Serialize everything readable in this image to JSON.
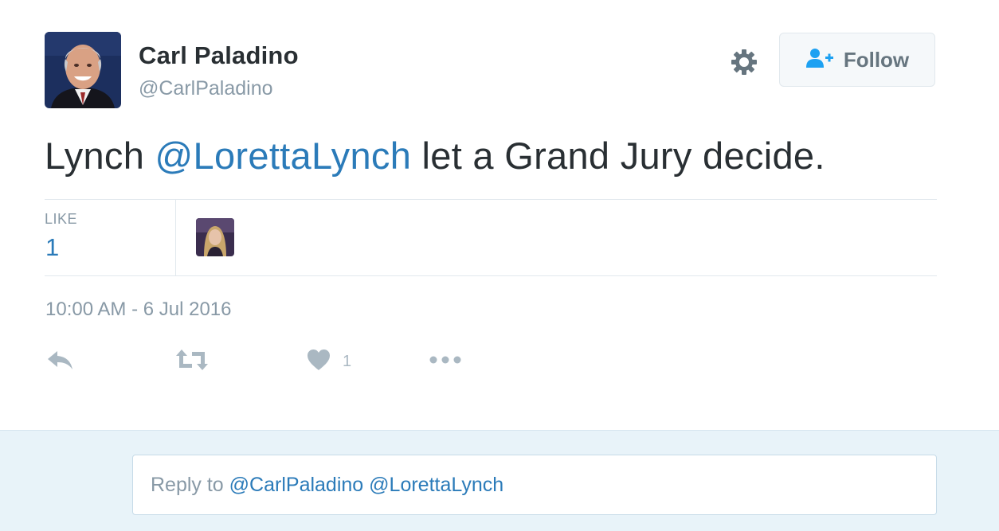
{
  "author": {
    "display_name": "Carl Paladino",
    "handle": "@CarlPaladino"
  },
  "header": {
    "settings_icon": "gear-icon",
    "follow_icon": "follow-user-icon",
    "follow_label": "Follow"
  },
  "tweet": {
    "text_before": "Lynch ",
    "mention": "@LorettaLynch",
    "text_after": " let a Grand Jury decide."
  },
  "stats": {
    "like_label": "LIKE",
    "like_count": "1"
  },
  "timestamp": "10:00 AM - 6 Jul 2016",
  "actions": {
    "reply_icon": "reply-icon",
    "retweet_icon": "retweet-icon",
    "like_icon": "heart-icon",
    "like_count": "1",
    "more_icon": "more-dots-icon"
  },
  "reply": {
    "prefix": "Reply to ",
    "mention_1": "@CarlPaladino",
    "mention_2": "@LorettaLynch"
  },
  "colors": {
    "link": "#2b7bb9",
    "muted": "#8899a6",
    "text": "#292f33",
    "reply_background": "#e8f3f9"
  }
}
